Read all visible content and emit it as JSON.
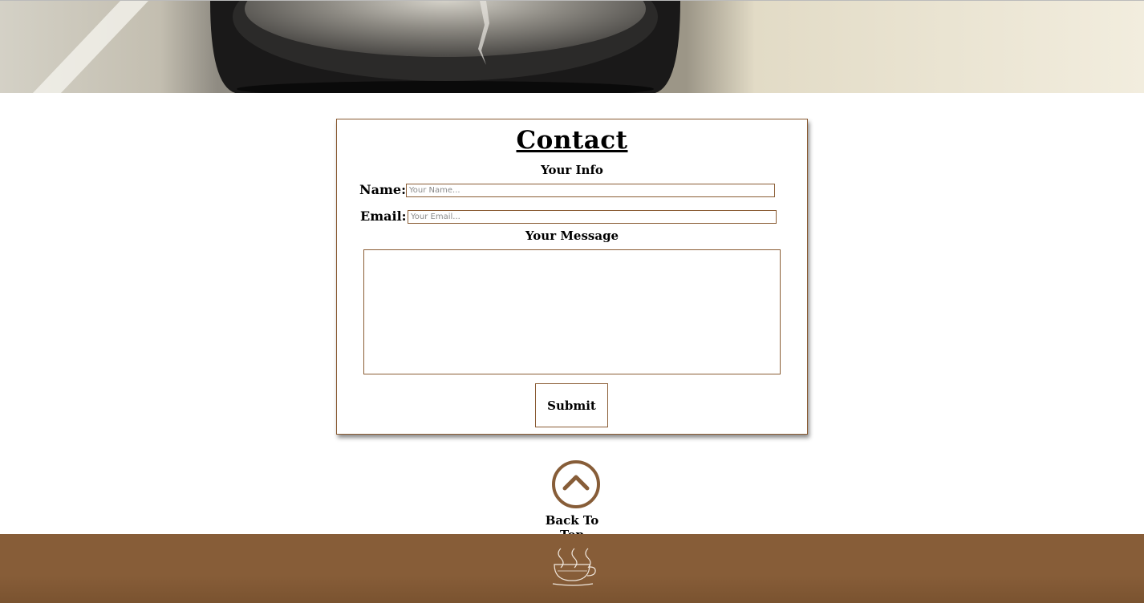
{
  "contact": {
    "title": "Contact",
    "info_heading": "Your Info",
    "name_label": "Name:",
    "name_placeholder": "Your Name...",
    "name_value": "",
    "email_label": "Email:",
    "email_placeholder": "Your Email...",
    "email_value": "",
    "message_heading": "Your Message",
    "message_value": "",
    "submit_label": "Submit"
  },
  "back_to_top": {
    "label": "Back To Top",
    "icon": "chevron-up-circle-icon"
  },
  "footer": {
    "logo_icon": "steaming-coffee-cup-icon"
  },
  "hero": {
    "image": "coffee-cup-photo"
  },
  "colors": {
    "accent_brown": "#875d38",
    "border_brown": "#8a5c34",
    "background": "#ffffff"
  }
}
